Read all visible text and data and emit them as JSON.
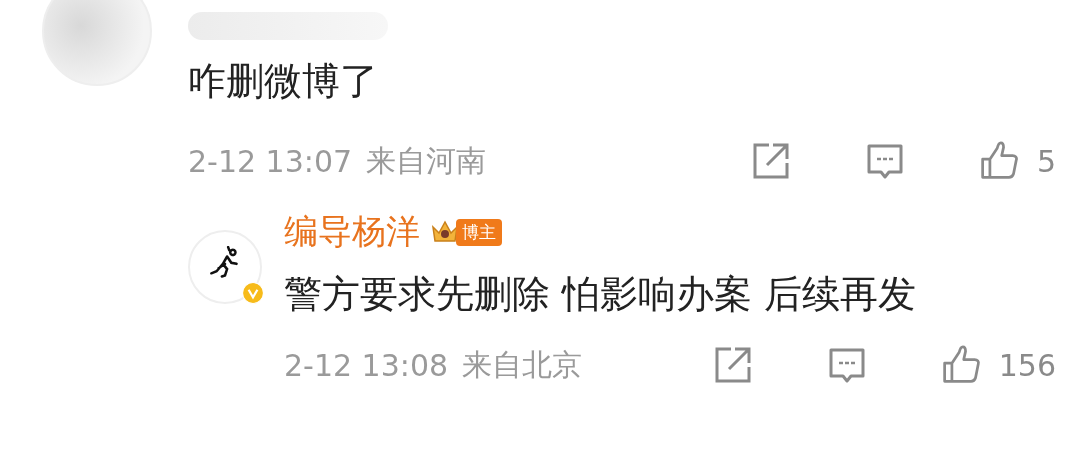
{
  "comment": {
    "text": "咋删微博了",
    "time": "2-12 13:07",
    "location": "来自河南",
    "likes": "5"
  },
  "reply": {
    "author": "编导杨洋",
    "badge": "博主",
    "verified": true,
    "text": "警方要求先删除 怕影响办案 后续再发",
    "time": "2-12 13:08",
    "location": "来自北京",
    "likes": "156"
  }
}
